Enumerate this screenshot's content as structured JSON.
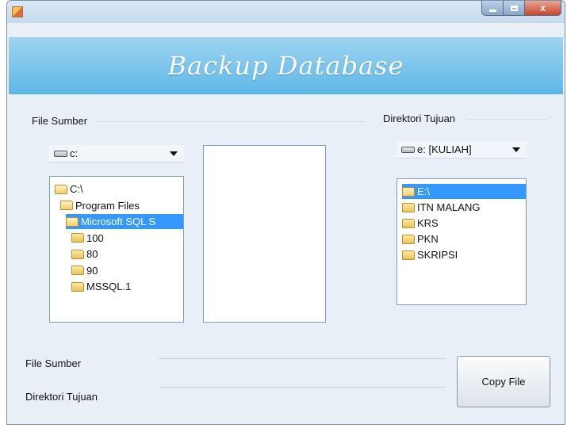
{
  "window": {
    "app_icon": "app-icon",
    "controls": [
      "minimize-icon",
      "maximize-icon",
      "close-icon"
    ],
    "close_glyph": "x"
  },
  "header": {
    "title": "Backup Database"
  },
  "source": {
    "group_label": "File Sumber",
    "drive": "c:",
    "tree": [
      {
        "label": "C:\\",
        "indent": 0,
        "open": true,
        "selected": false
      },
      {
        "label": "Program Files",
        "indent": 1,
        "open": true,
        "selected": false
      },
      {
        "label": "Microsoft SQL S",
        "indent": 2,
        "open": true,
        "selected": true
      },
      {
        "label": "100",
        "indent": 3,
        "open": false,
        "selected": false
      },
      {
        "label": "80",
        "indent": 3,
        "open": false,
        "selected": false
      },
      {
        "label": "90",
        "indent": 3,
        "open": false,
        "selected": false
      },
      {
        "label": "MSSQL.1",
        "indent": 3,
        "open": false,
        "selected": false
      }
    ]
  },
  "destination": {
    "group_label": "Direktori Tujuan",
    "drive": "e: [KULIAH]",
    "tree": [
      {
        "label": "E:\\",
        "selected": true,
        "open": true
      },
      {
        "label": "ITN MALANG",
        "selected": false,
        "open": false
      },
      {
        "label": "KRS",
        "selected": false,
        "open": false
      },
      {
        "label": "PKN",
        "selected": false,
        "open": false
      },
      {
        "label": "SKRIPSI",
        "selected": false,
        "open": false
      }
    ]
  },
  "form": {
    "file_sumber_label": "File Sumber",
    "direktori_tujuan_label": "Direktori Tujuan",
    "file_sumber_value": "",
    "direktori_tujuan_value": ""
  },
  "copy_button": {
    "label": "Copy File"
  }
}
